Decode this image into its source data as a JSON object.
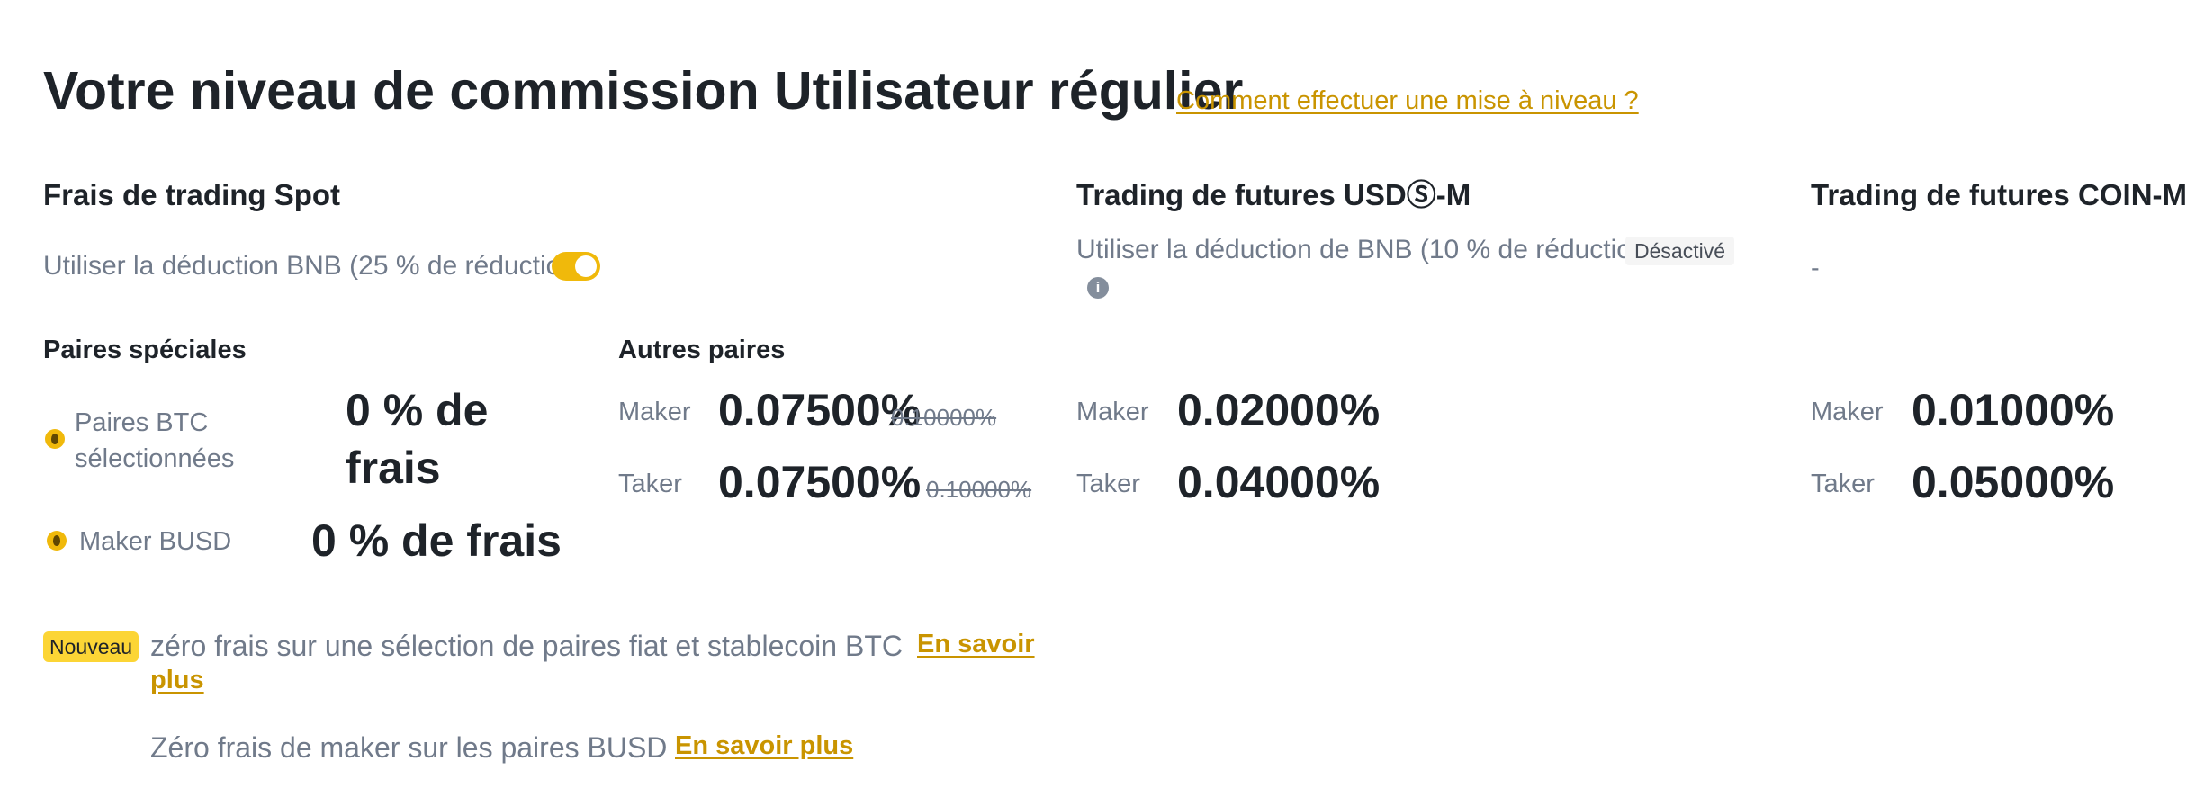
{
  "header": {
    "title": "Votre niveau de commission Utilisateur régulier",
    "upgrade_link": "Comment effectuer une mise à niveau ?"
  },
  "spot": {
    "heading": "Frais de trading Spot",
    "bnb_deduction_label": "Utiliser la déduction BNB (25 % de réduction)",
    "bnb_toggle_on": true,
    "special_pairs": {
      "heading": "Paires spéciales",
      "btc_label": "Paires BTC sélectionnées",
      "btc_fee": "0 % de frais",
      "busd_label": "Maker BUSD",
      "busd_fee": "0 % de frais"
    },
    "other_pairs": {
      "heading": "Autres paires",
      "maker_label": "Maker",
      "maker_value": "0.07500%",
      "maker_original": "0.10000%",
      "taker_label": "Taker",
      "taker_value": "0.07500%",
      "taker_original": "0.10000%"
    }
  },
  "usdm": {
    "heading": "Trading de futures USDⓈ-M",
    "bnb_deduction_label": "Utiliser la déduction de BNB (10 % de réduction)",
    "status_badge": "Désactivé",
    "maker_label": "Maker",
    "maker_value": "0.02000%",
    "taker_label": "Taker",
    "taker_value": "0.04000%"
  },
  "coinm": {
    "heading": "Trading de futures COIN-M",
    "placeholder": "-",
    "maker_label": "Maker",
    "maker_value": "0.01000%",
    "taker_label": "Taker",
    "taker_value": "0.05000%"
  },
  "promos": {
    "badge": "Nouveau",
    "line1_text": "zéro frais sur une sélection de paires fiat et stablecoin BTC",
    "line1_link_a": "En savoir",
    "line1_link_b": "plus",
    "line2_text": "Zéro frais de maker sur les paires BUSD",
    "line2_link": "En savoir plus"
  },
  "colors": {
    "accent": "#f0b90b",
    "link": "#c99400",
    "text_primary": "#1e2329",
    "text_secondary": "#707a8a"
  }
}
